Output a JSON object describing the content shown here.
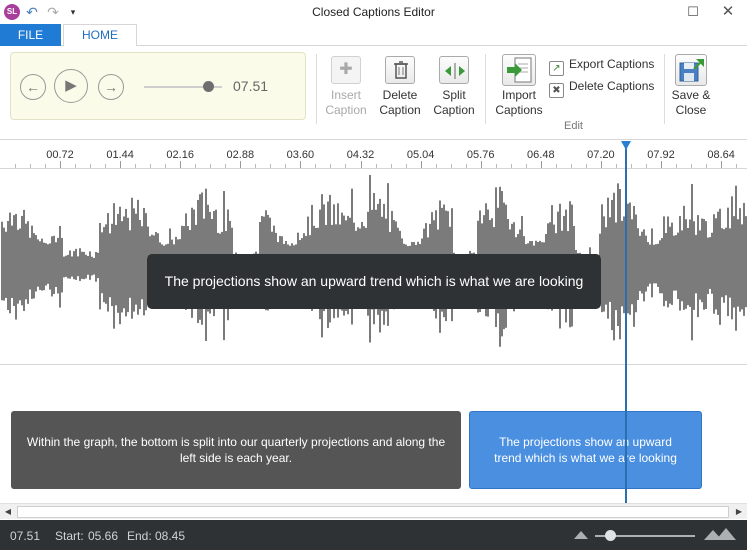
{
  "app": {
    "icon_text": "SL",
    "window_title": "Closed Captions Editor",
    "quick_access": {
      "undo": "↶",
      "redo": "↷",
      "customize": "▾"
    },
    "window_buttons": {
      "maximize": "☐",
      "close": "✕"
    }
  },
  "ribbon": {
    "tabs": [
      {
        "label": "FILE",
        "active": false
      },
      {
        "label": "HOME",
        "active": true
      }
    ],
    "player": {
      "prev_icon": "←",
      "play_icon": "▶",
      "next_icon": "→",
      "volume_fraction": 0.82,
      "time": "07.51"
    },
    "buttons": {
      "insert": {
        "line1": "Insert",
        "line2": "Caption",
        "enabled": false
      },
      "delete": {
        "line1": "Delete",
        "line2": "Caption",
        "enabled": true
      },
      "split": {
        "line1": "Split",
        "line2": "Caption",
        "enabled": true
      },
      "import": {
        "line1": "Import",
        "line2": "Captions",
        "enabled": true
      },
      "export": {
        "label": "Export Captions"
      },
      "delete_all": {
        "label": "Delete Captions"
      },
      "save": {
        "line1": "Save &",
        "line2": "Close"
      }
    },
    "group_label": "Edit"
  },
  "timeline": {
    "tick_labels": [
      "00.72",
      "01.44",
      "02.16",
      "02.88",
      "03.60",
      "04.32",
      "05.04",
      "05.76",
      "06.48",
      "07.20",
      "07.92",
      "08.64"
    ]
  },
  "waveform": {
    "caption_overlay": "The projections show an upward trend which is what we are looking"
  },
  "captions": [
    {
      "text": "Within the graph, the bottom is split into our quarterly projections and along the left side is each year.",
      "selected": false
    },
    {
      "text": "The projections show an upward trend which is what we are looking",
      "selected": true
    }
  ],
  "status": {
    "current": "07.51",
    "start_label": "Start:",
    "start_value": "05.66",
    "end_label": "End:",
    "end_value": "08.45"
  },
  "colors": {
    "accent": "#1f7bd3",
    "selected_caption": "#4a8fe0",
    "caption_block": "#555555",
    "dark_bar": "#2e3234",
    "waveform": "#5a5a5a",
    "player_bg": "#fbfbe9"
  }
}
